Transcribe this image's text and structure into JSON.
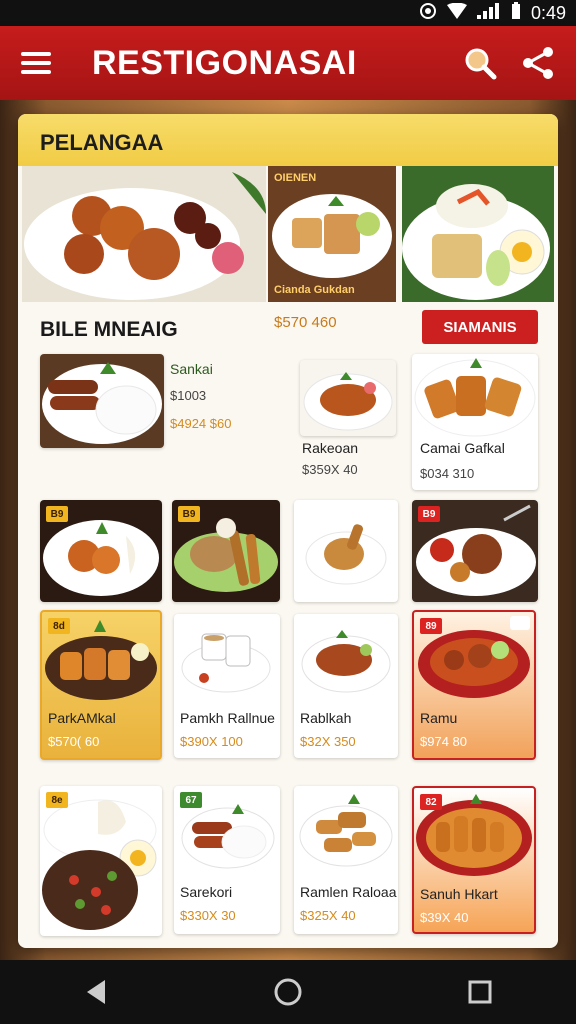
{
  "status": {
    "time": "0:49"
  },
  "app": {
    "title": "RESTIGONASAI"
  },
  "main": {
    "section_title": "PELANGAA",
    "hero": [
      {
        "label": "OIENEN"
      },
      {
        "label": "Cianda Gukdan"
      }
    ],
    "subtitle": "BILE MNEAIG",
    "featured_price": "$570  460",
    "badge": "SIAMANIS"
  },
  "row1": [
    {
      "name": "Sankai",
      "price1": "$1003",
      "price2": "$4924   $60"
    },
    {
      "name": "Rakeoan",
      "price": "$359X  40"
    },
    {
      "name": "Camai Gafkal",
      "price": "$034   310"
    }
  ],
  "row2_badges": [
    "B9",
    "B9",
    "",
    "B9"
  ],
  "row3": [
    {
      "badge": "8d",
      "name": "ParkAMkal",
      "price": "$570(  60"
    },
    {
      "badge": "",
      "name": "Pamkh Rallnue",
      "price": "$390X  100"
    },
    {
      "badge": "",
      "name": "Rablkah",
      "price": "$32X   350"
    },
    {
      "badge": "89",
      "name": "Ramu",
      "price": "$974   80"
    }
  ],
  "row4": [
    {
      "badge": "8e",
      "name": "",
      "price": ""
    },
    {
      "badge": "67",
      "name": "Sarekori",
      "price": "$330X   30"
    },
    {
      "badge": "",
      "name": "Ramlen Raloaa",
      "price": "$325X  40"
    },
    {
      "badge": "82",
      "name": "Sanuh Hkart",
      "price": "$39X   40"
    }
  ],
  "colors": {
    "brand_red": "#c61c1c",
    "header_yellow": "#f1cc45",
    "price_orange": "#d58b1d"
  },
  "icons": [
    "hamburger-menu-icon",
    "search-icon",
    "share-icon",
    "wifi-icon",
    "signal-icon",
    "back-icon",
    "home-icon",
    "recents-icon"
  ]
}
